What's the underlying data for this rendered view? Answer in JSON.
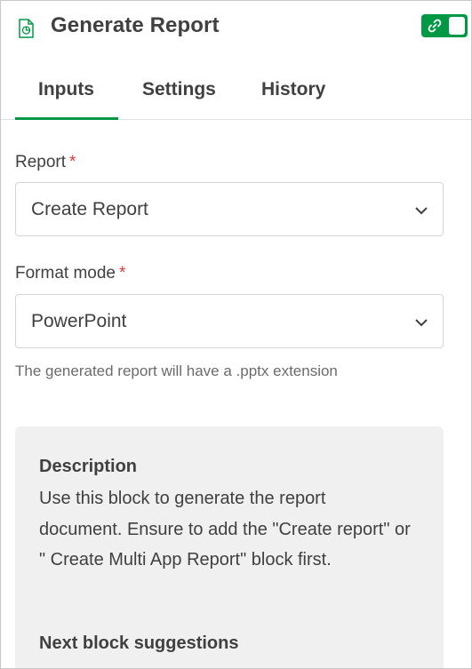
{
  "header": {
    "title": "Generate Report",
    "icon": "report-file-icon",
    "toggle_icon": "link-icon",
    "accent_color": "#009845"
  },
  "tabs": [
    {
      "label": "Inputs",
      "active": true
    },
    {
      "label": "Settings",
      "active": false
    },
    {
      "label": "History",
      "active": false
    }
  ],
  "form": {
    "report": {
      "label": "Report",
      "required_mark": "*",
      "value": "Create Report"
    },
    "format_mode": {
      "label": "Format mode",
      "required_mark": "*",
      "value": "PowerPoint"
    },
    "helper_text": "The generated report will have a .pptx extension"
  },
  "description": {
    "title": "Description",
    "text": "Use this block to generate the report document. Ensure to add the \"Create report\" or \" Create Multi App Report\" block first.",
    "next_title": "Next block suggestions"
  }
}
